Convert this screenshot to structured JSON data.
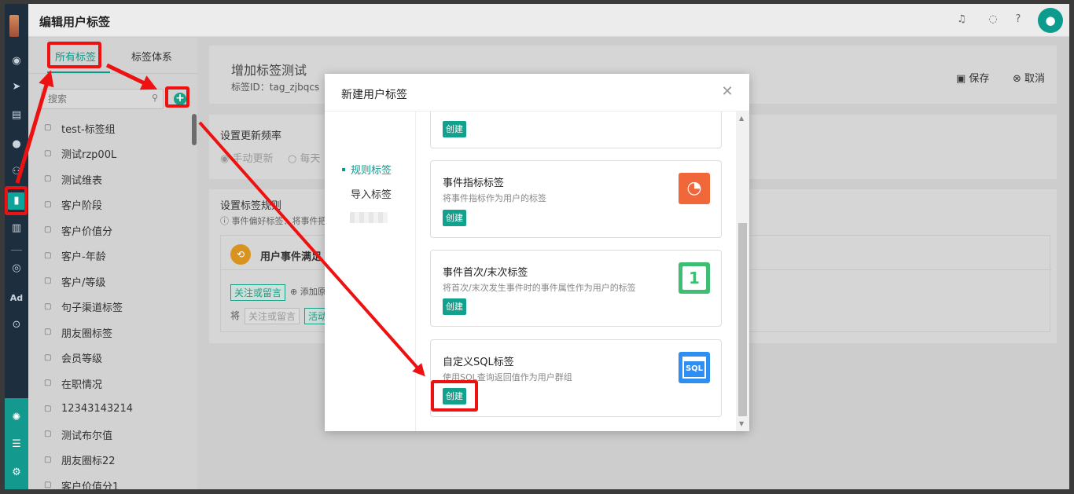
{
  "header": {
    "title": "编辑用户标签"
  },
  "tabs": [
    {
      "label": "所有标签"
    },
    {
      "label": "标签体系"
    }
  ],
  "search": {
    "placeholder": "搜索"
  },
  "tag_list": [
    "test-标签组",
    "测试rzp00L",
    "测试维表",
    "客户阶段",
    "客户价值分",
    "客户-年龄",
    "客户/等级",
    "句子渠道标签",
    "朋友圈标签",
    "会员等级",
    "在职情况",
    "12343143214",
    "测试布尔值",
    "朋友圈标22",
    "客户价值分1"
  ],
  "content": {
    "title": "增加标签测试",
    "tag_id": "标签ID：tag_zjbqcs",
    "save": "保存",
    "cancel": "取消",
    "update_freq": "设置更新频率",
    "manual": "手动更新",
    "daily": "每天",
    "rule": "设置标签规则",
    "rule_note": "事件偏好标签：将事件把",
    "rule_card_title": "用户事件满足",
    "chip1": "关注或留言",
    "add": "添加原",
    "jiang": "将",
    "chip2": "关注或留言",
    "chip3": "活动"
  },
  "modal": {
    "title": "新建用户标签",
    "sidebar": [
      {
        "label": "规则标签"
      },
      {
        "label": "导入标签"
      }
    ],
    "create_label": "创建",
    "cards": [
      {
        "title": "事件指标标签",
        "desc": "将事件指标作为用户的标签",
        "icon": "gauge-icon",
        "color": "#f0673a"
      },
      {
        "title": "事件首次/末次标签",
        "desc": "将首次/末次发生事件时的事件属性作为用户的标签",
        "icon": "number-one-icon",
        "color": "#3dbe73",
        "icon_text": "1"
      },
      {
        "title": "自定义SQL标签",
        "desc": "使用SQL查询返回值作为用户群组",
        "icon": "sql-icon",
        "color": "#2f8ef1",
        "icon_text": "SQL"
      }
    ]
  },
  "rail_icons": [
    "dashboard-icon",
    "send-icon",
    "layout-icon",
    "user-icon",
    "users-icon",
    "tag-icon",
    "bar-chart-icon",
    "wechat-icon",
    "ad-icon",
    "compass-icon",
    "robot-icon",
    "server-icon",
    "settings-icon"
  ],
  "rail_ad_text": "Ad"
}
